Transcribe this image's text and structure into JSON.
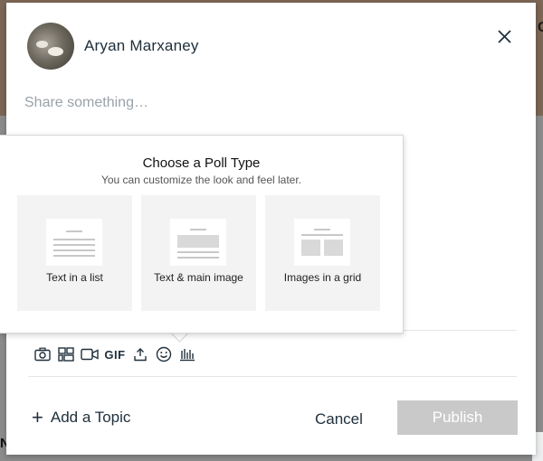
{
  "background": {
    "corner_text": "C",
    "bottom_text": "N"
  },
  "post_composer": {
    "user_name": "Aryan Marxaney",
    "share_placeholder": "Share something…",
    "toolbar": {
      "icons": [
        "camera-icon",
        "gallery-icon",
        "video-icon",
        "gif-icon",
        "upload-icon",
        "emoji-icon",
        "poll-icon"
      ],
      "gif_label": "GIF"
    },
    "add_topic_label": "Add a Topic",
    "cancel_label": "Cancel",
    "publish_label": "Publish"
  },
  "poll_popover": {
    "title": "Choose a Poll Type",
    "subtitle": "You can customize the look and feel later.",
    "options": [
      {
        "label": "Text in a list"
      },
      {
        "label": "Text & main image"
      },
      {
        "label": "Images in a grid"
      }
    ]
  },
  "colors": {
    "text_primary": "#20303c",
    "placeholder": "#9aa2a8",
    "publish_disabled_bg": "#c9c9c9",
    "card_bg": "#f3f3f3"
  }
}
